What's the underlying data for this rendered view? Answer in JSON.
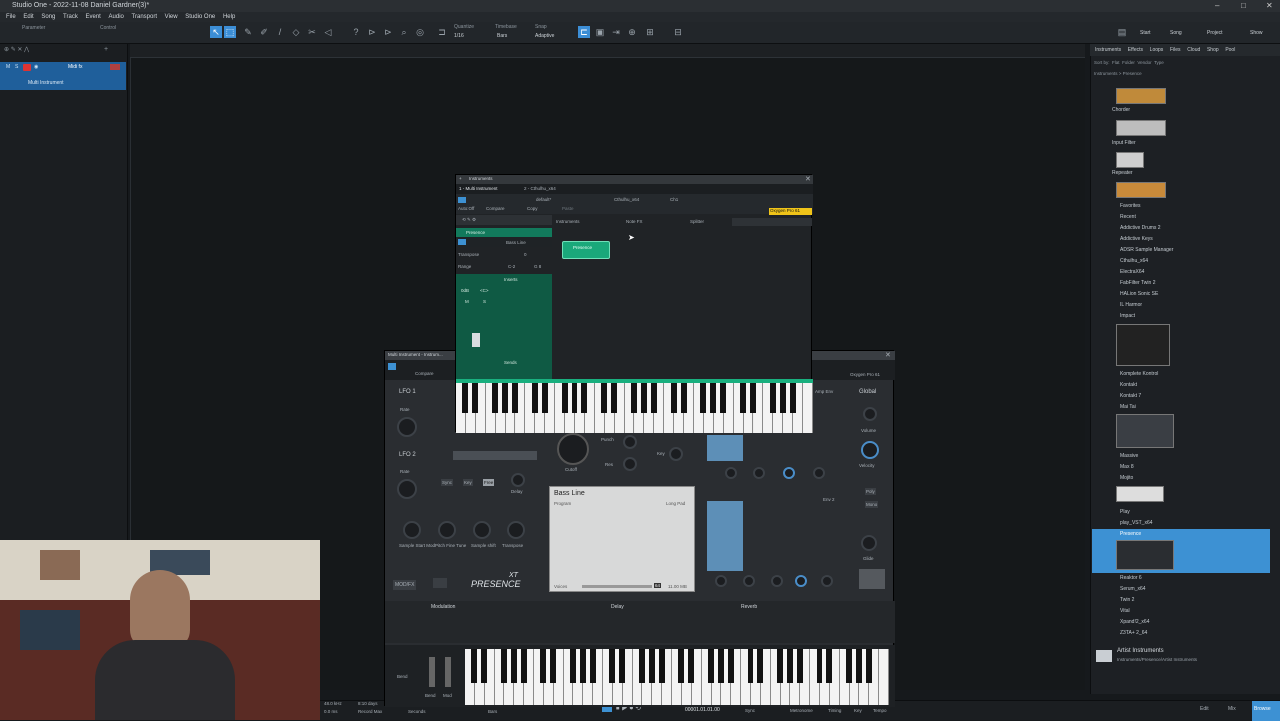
{
  "window": {
    "title": "Studio One - 2022-11-08 Daniel Gardner(3)*"
  },
  "menu": [
    "File",
    "Edit",
    "Song",
    "Track",
    "Event",
    "Audio",
    "Transport",
    "View",
    "Studio One",
    "Help"
  ],
  "toolbar": {
    "parameter_label": "Parameter",
    "control_label": "Control",
    "quantize_label": "Quantize",
    "quantize_value": "1/16",
    "timebase_label": "Timebase",
    "timebase_value": "Bars",
    "snap_label": "Snap",
    "snap_value": "Adaptive",
    "start_label": "Start",
    "song_label": "Song",
    "project_label": "Project",
    "show_label": "Show"
  },
  "track": {
    "name": "Midi fx",
    "sub": "Multi Instrument"
  },
  "browser": {
    "tabs": [
      "Instruments",
      "Effects",
      "Loops",
      "Files",
      "Cloud",
      "Shop",
      "Pool"
    ],
    "filters": [
      "Sort by:",
      "Flat",
      "Folder",
      "Vendor",
      "Type"
    ],
    "path": "Instruments > Presence",
    "items": [
      "Chorder",
      "Input Filter",
      "Repeater",
      "Favorites",
      "Recent",
      "Addictive Drums 2",
      "Addictive Keys",
      "ADSR Sample Manager",
      "Cthulhu_x64",
      "ElectraX64",
      "FabFilter Twin 2",
      "HALion Sonic SE",
      "IL Harmor",
      "Impact",
      "Komplete Kontrol",
      "Kontakt",
      "Kontakt 7",
      "Mai Tai",
      "Massive",
      "Max 8",
      "Mojito",
      "Play",
      "play_VST_x64",
      "Presence",
      "Reaktor 6",
      "Serum_x64",
      "Twin 2",
      "Vital",
      "Xpand!2_x64",
      "Z3TA+ 2_64"
    ],
    "artist_title": "Artist Instruments",
    "artist_path": "Instruments/Presence/Artist Instruments"
  },
  "instwin": {
    "title": "Instruments",
    "tab1": "1 - Multi Instrument",
    "tab2": "2 - Cthulhu_x64",
    "preset": "default*",
    "compare": "Compare",
    "copy": "Copy",
    "paste": "Paste",
    "autooff": "Auto:Off",
    "cthulhu": "Cthulhu_x64",
    "ch": "Ch1",
    "keyboard": "Oxygen Pro 61",
    "row_instruments": "Instruments",
    "row_notefx": "Note FX",
    "row_splitter": "Splitter",
    "presence": "Presence",
    "bassline": "Bass Line",
    "transpose_label": "Transpose",
    "transpose_value": "0",
    "range_label": "Range",
    "range_lo": "C-2",
    "range_hi": "G 8",
    "inserts": "Inserts",
    "sends": "Sends",
    "gain": "0dB",
    "pan": "<C>",
    "mute": "M",
    "solo": "S",
    "node": "Presence"
  },
  "presence": {
    "title": "Multi Instrument - Instrum...",
    "keyboard": "Oxygen Pro 61",
    "compare": "Compare",
    "lfo1": "LFO 1",
    "lfo2": "LFO 2",
    "rate": "Rate",
    "sync": "Sync",
    "key": "Key",
    "free": "Free",
    "delay": "Delay",
    "sample_start": "Sample Start Mod",
    "pitch_fine": "Pitch Fine Tune",
    "sample_shift": "Sample shift",
    "transpose": "Transpose",
    "modfx": "MOD/FX",
    "logo": "PRESENCE",
    "logo_xt": "XT",
    "program_name": "Bass Line",
    "program_label": "Program",
    "program_type": "Long Pad",
    "voices": "Voices",
    "mem": "11.00 MB",
    "voices_val": "64",
    "amp_env": "Amp Env",
    "env2": "Env 2",
    "global": "Global",
    "volume": "Volume",
    "velocity": "Velocity",
    "glide": "Glide",
    "poly": "Poly",
    "mono": "Mono",
    "cutoff": "Cutoff",
    "punch": "Punch",
    "res": "Res",
    "key2": "Key",
    "modulation": "Modulation",
    "delay_fx": "Delay",
    "reverb": "Reverb",
    "bend": "Bend",
    "mod": "Mod"
  },
  "status": {
    "rate": "48.0 kHz",
    "time": "0.0 ms",
    "days": "8:10 days",
    "rec_max": "Record Max",
    "seconds": "Seconds",
    "bars": "Bars",
    "position": "00001.01.01.00",
    "sync": "Sync",
    "metronome": "Metronome",
    "timing": "Timing",
    "key": "Key",
    "tempo": "Tempo",
    "edit": "Edit",
    "mix": "Mix",
    "browse": "Browse"
  }
}
